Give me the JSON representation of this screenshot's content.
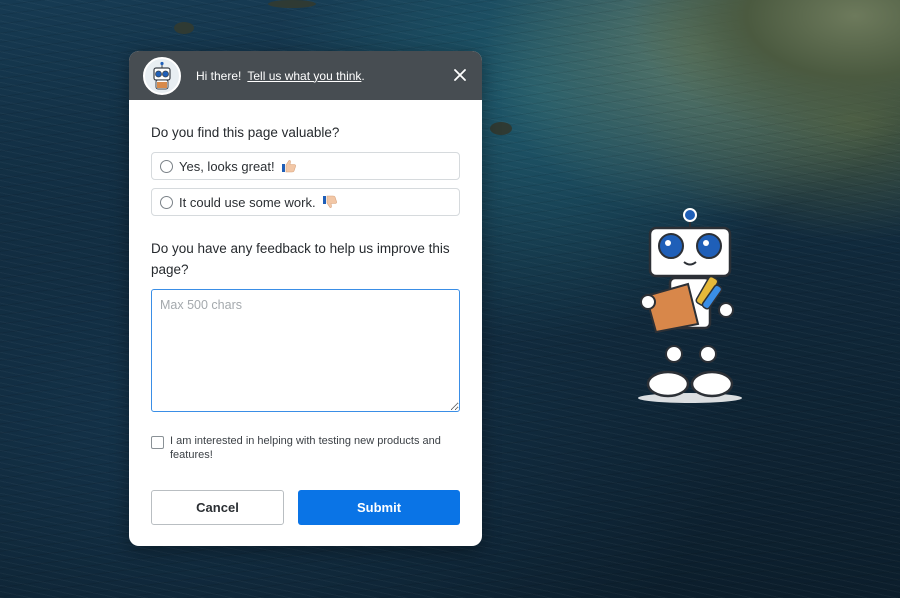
{
  "header": {
    "greeting": "Hi there!",
    "link_text": "Tell us what you think",
    "link_suffix": ".",
    "close_icon": "close-icon"
  },
  "question1": {
    "text": "Do you find this page valuable?",
    "options": [
      {
        "label": "Yes, looks great!",
        "icon": "thumbs-up-icon"
      },
      {
        "label": "It could use some work.",
        "icon": "thumbs-down-icon"
      }
    ]
  },
  "question2": {
    "text": "Do you have any feedback to help us improve this page?",
    "placeholder": "Max 500 chars",
    "value": ""
  },
  "consent": {
    "label": "I am interested in helping with testing new products and features!",
    "checked": false
  },
  "actions": {
    "cancel_label": "Cancel",
    "submit_label": "Submit"
  },
  "colors": {
    "header_bg": "#474d52",
    "accent": "#0a74e6",
    "textarea_focus": "#3a8ee6"
  }
}
